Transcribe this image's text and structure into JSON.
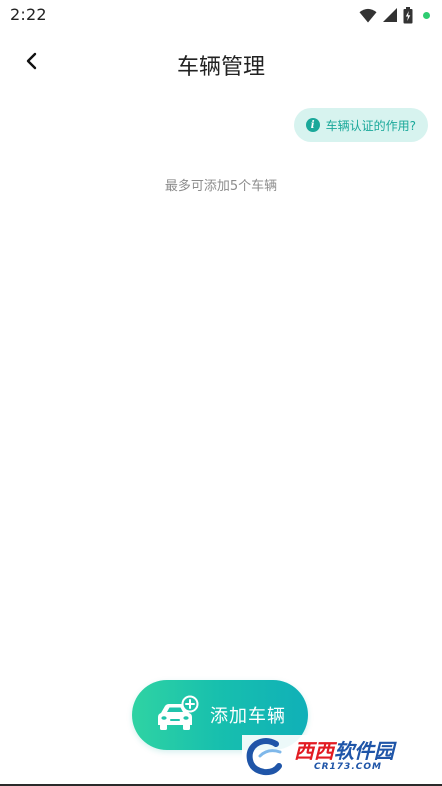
{
  "status_bar": {
    "time": "2:22",
    "icons": [
      "wifi-icon",
      "signal-icon",
      "battery-charging-icon"
    ],
    "dot_color": "#2ecc71"
  },
  "header": {
    "title": "车辆管理",
    "back_icon": "chevron-left-icon"
  },
  "certification": {
    "label": "车辆认证的作用?",
    "icon": "info-icon",
    "icon_color": "#1aa89a",
    "bg_color": "#d7f3ef"
  },
  "hint": {
    "text": "最多可添加5个车辆"
  },
  "add_vehicle": {
    "label": "添加车辆",
    "icon": "car-add-icon"
  },
  "watermark": {
    "brand_red": "西西",
    "brand_blue": "软件园",
    "sub": "CR173.COM"
  }
}
